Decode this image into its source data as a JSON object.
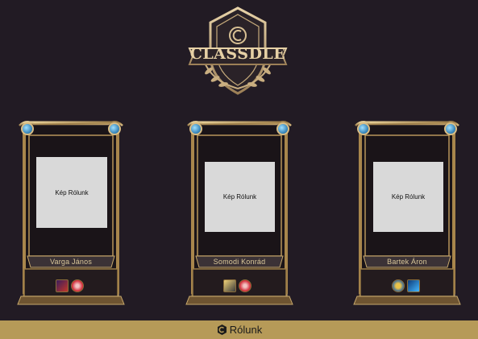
{
  "logo": {
    "text": "CLASSDLE"
  },
  "cards": [
    {
      "photo_label": "Kép Rólunk",
      "name": "Varga János",
      "badges": [
        "red-champion-icon",
        "pink-role-icon"
      ]
    },
    {
      "photo_label": "Kép Rólunk",
      "name": "Somodi Konrád",
      "badges": [
        "gold-champion-icon",
        "pink-role-icon"
      ]
    },
    {
      "photo_label": "Kép Rólunk",
      "name": "Bartek Áron",
      "badges": [
        "wow-logo-icon",
        "blue-dragon-icon"
      ]
    }
  ],
  "footer": {
    "link_label": "Rólunk"
  },
  "colors": {
    "background": "#221b24",
    "gold": "#b69a58",
    "footer": "#b69a58",
    "gem": "#3aa0d8"
  }
}
